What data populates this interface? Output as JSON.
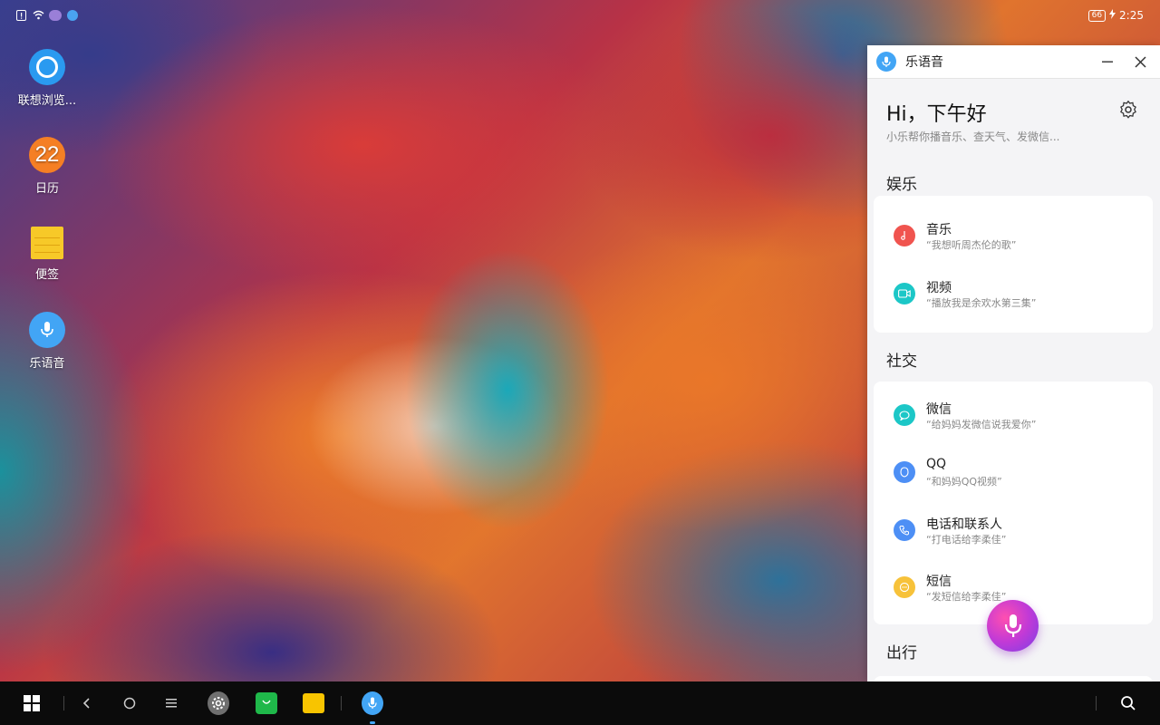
{
  "status_bar": {
    "time": "2:25",
    "battery": "66"
  },
  "desktop": {
    "icons": [
      {
        "label": "联想浏览..."
      },
      {
        "label": "日历",
        "day": "22"
      },
      {
        "label": "便签"
      },
      {
        "label": "乐语音"
      }
    ]
  },
  "voice_panel": {
    "title": "乐语音",
    "greeting": "Hi，下午好",
    "subtitle": "小乐帮你播音乐、查天气、发微信...",
    "sections": [
      {
        "title": "娱乐",
        "items": [
          {
            "name": "音乐",
            "hint": "“我想听周杰伦的歌”",
            "color": "#f0544f"
          },
          {
            "name": "视频",
            "hint": "“播放我是余欢水第三集”",
            "color": "#1cc7c7"
          }
        ]
      },
      {
        "title": "社交",
        "items": [
          {
            "name": "微信",
            "hint": "“给妈妈发微信说我爱你”",
            "color": "#1cc7c7"
          },
          {
            "name": "QQ",
            "hint": "“和妈妈QQ视频”",
            "color": "#4d8ff5"
          },
          {
            "name": "电话和联系人",
            "hint": "“打电话给李柔佳”",
            "color": "#4d8ff5"
          },
          {
            "name": "短信",
            "hint": "“发短信给李柔佳”",
            "color": "#f7c23a"
          }
        ]
      },
      {
        "title": "出行",
        "items": []
      }
    ]
  },
  "taskbar": {
    "apps": [
      "start-menu",
      "back",
      "home",
      "menu",
      "settings",
      "app-store",
      "file-manager",
      "voice-assistant",
      "search"
    ]
  }
}
